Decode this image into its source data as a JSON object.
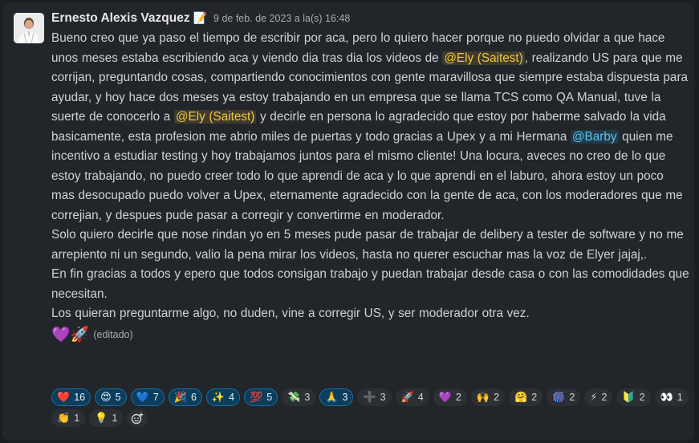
{
  "author": "Ernesto Alexis Vazquez",
  "status_emoji": "📝",
  "timestamp": "9 de feb. de 2023 a la(s) 16:48",
  "paragraphs": {
    "p1": {
      "a": "Bueno creo que ya paso el tiempo de escribir por aca, pero lo quiero hacer porque no puedo olvidar a que hace unos meses estaba escribiendo aca y viendo dia tras dia los videos de ",
      "m1": "@Ely (Saitest)",
      "b": ", realizando US para que me corrijan, preguntando cosas, compartiendo conocimientos con gente maravillosa que siempre estaba dispuesta para ayudar, y hoy hace dos meses ya estoy trabajando en un empresa que se llama TCS como QA Manual, tuve la suerte de conocerlo a ",
      "m2": "@Ely (Saitest)",
      "c": " y decirle en persona lo agradecido que estoy por haberme salvado la vida basicamente, esta profesion me abrio miles de puertas y todo gracias a Upex y a mi Hermana ",
      "m3": "@Barby",
      "d": " quien me incentivo a estudiar testing y hoy trabajamos juntos para el mismo cliente! Una locura, aveces no creo de lo que estoy trabajando, no puedo creer todo lo que aprendi de aca y lo que aprendi en el laburo, ahora estoy un poco mas desocupado puedo volver a Upex, eternamente agradecido con la gente de aca, con los moderadores que me correjian, y despues pude pasar a corregir y convertirme en moderador."
    },
    "p2": "Solo quiero decirle que nose rindan yo en 5 meses pude pasar de trabajar de delibery a tester de software y no me arrepiento ni un segundo, valio la pena mirar los videos, hasta no querer escuchar mas la voz de Elyer jajaj,.",
    "p3": "En fin gracias a todos y epero que todos consigan trabajo y puedan trabajar desde casa o con las comodidades que necesitan.",
    "p4": "Los quieran preguntarme algo, no duden, vine a corregir US, y ser moderador otra vez."
  },
  "trailing_emoji": "💜🚀",
  "edited_label": "(editado)",
  "reactions": [
    {
      "emoji": "❤️",
      "count": "16",
      "selected": true
    },
    {
      "emoji": "😍",
      "count": "5",
      "selected": true
    },
    {
      "emoji": "💙",
      "count": "7",
      "selected": true
    },
    {
      "emoji": "🎉",
      "count": "6",
      "selected": true
    },
    {
      "emoji": "✨",
      "count": "4",
      "selected": true
    },
    {
      "emoji": "💯",
      "count": "5",
      "selected": true
    },
    {
      "emoji": "💸",
      "count": "3",
      "selected": false
    },
    {
      "emoji": "🙏",
      "count": "3",
      "selected": true
    },
    {
      "emoji": "➕",
      "count": "3",
      "selected": false
    },
    {
      "emoji": "🚀",
      "count": "4",
      "selected": false
    },
    {
      "emoji": "💜",
      "count": "2",
      "selected": false
    },
    {
      "emoji": "🙌",
      "count": "2",
      "selected": false
    },
    {
      "emoji": "🤗",
      "count": "2",
      "selected": false
    },
    {
      "emoji": "🎆",
      "count": "2",
      "selected": false
    },
    {
      "emoji": "⚡",
      "count": "2",
      "selected": false
    },
    {
      "emoji": "🔰",
      "count": "2",
      "selected": false
    },
    {
      "emoji": "👀",
      "count": "1",
      "selected": false
    },
    {
      "emoji": "👏",
      "count": "1",
      "selected": false
    },
    {
      "emoji": "💡",
      "count": "1",
      "selected": false
    }
  ],
  "colors": {
    "background": "#1a1d21",
    "message_bg": "#222529",
    "mention_yellow": "#f2c744",
    "mention_blue": "#5dc3f1",
    "reaction_selected": "#0b3d5c"
  },
  "icons": {
    "add_reaction": "add-reaction-icon"
  }
}
